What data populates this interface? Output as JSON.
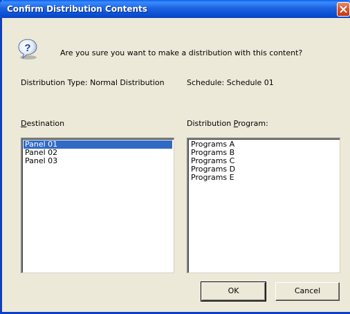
{
  "dialog": {
    "title": "Confirm Distribution Contents",
    "message": "Are you sure you want to make a distribution with this content?",
    "distribution_type": "Distribution Type: Normal Distribution",
    "schedule": "Schedule: Schedule 01"
  },
  "destination": {
    "label_prefix": "",
    "label_key": "D",
    "label_rest": "estination",
    "items": [
      "Panel 01",
      "Panel 02",
      "Panel 03"
    ],
    "selected": "Panel 01"
  },
  "program": {
    "label_prefix": "Distribution ",
    "label_key": "P",
    "label_rest": "rogram:",
    "items": [
      "Programs A",
      "Programs B",
      "Programs C",
      "Programs D",
      "Programs E"
    ]
  },
  "buttons": {
    "ok": "OK",
    "cancel": "Cancel"
  },
  "icons": {
    "message": "question-icon",
    "close": "close-icon"
  },
  "colors": {
    "titlebar": "#0b4fd3",
    "selection": "#316ac5",
    "dialog_bg": "#ece9d8"
  }
}
